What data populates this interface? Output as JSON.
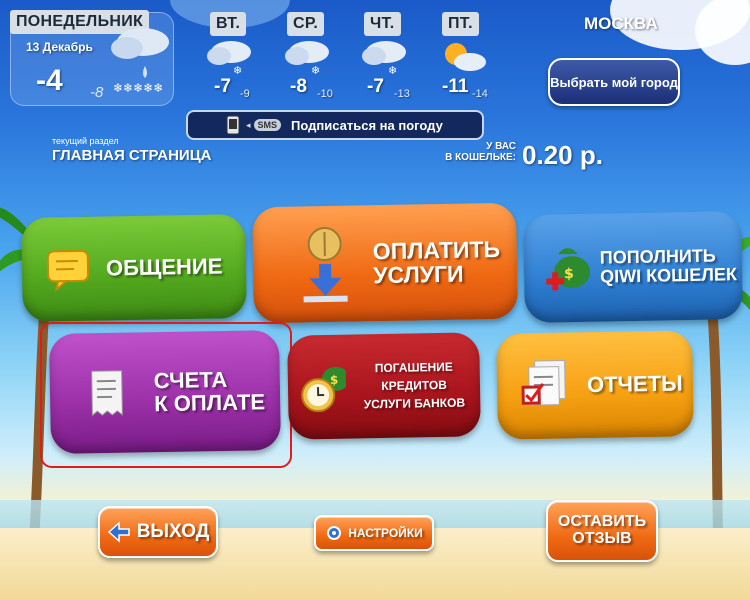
{
  "weather": {
    "today": {
      "day": "ПОНЕДЕЛЬНИК",
      "date": "13 Декабрь",
      "temp_hi": "-4",
      "temp_lo": "-8"
    },
    "forecast": [
      {
        "day": "ВТ.",
        "temp_hi": "-7",
        "temp_lo": "-9",
        "icon": "snow-cloud-icon"
      },
      {
        "day": "СР.",
        "temp_hi": "-8",
        "temp_lo": "-10",
        "icon": "snow-cloud-icon"
      },
      {
        "day": "ЧТ.",
        "temp_hi": "-7",
        "temp_lo": "-13",
        "icon": "snow-cloud-icon"
      },
      {
        "day": "ПТ.",
        "temp_hi": "-11",
        "temp_lo": "-14",
        "icon": "sun-cloud-icon"
      }
    ],
    "city": "МОСКВА",
    "choose_city": "Выбрать мой город",
    "subscribe_sms": "SMS",
    "subscribe_text": "Подписаться на погоду"
  },
  "section": {
    "caption": "текущий раздел",
    "name": "ГЛАВНАЯ СТРАНИЦА"
  },
  "wallet": {
    "line1": "У ВАС",
    "line2": "В КОШЕЛЬКЕ:",
    "amount": "0.20 р."
  },
  "tiles": {
    "communication": "ОБЩЕНИЕ",
    "pay_services_1": "ОПЛАТИТЬ",
    "pay_services_2": "УСЛУГИ",
    "topup_1": "ПОПОЛНИТЬ",
    "topup_2": "QIWI КОШЕЛЕК",
    "invoices_1": "СЧЕТА",
    "invoices_2": "К ОПЛАТЕ",
    "credits_1": "ПОГАШЕНИЕ КРЕДИТОВ",
    "credits_2": "УСЛУГИ БАНКОВ",
    "reports": "ОТЧЕТЫ"
  },
  "bottom": {
    "exit": "ВЫХОД",
    "settings": "НАСТРОЙКИ",
    "feedback_1": "ОСТАВИТЬ",
    "feedback_2": "ОТЗЫВ"
  },
  "colors": {
    "green": "#52a81e",
    "orange": "#f06a14",
    "blue": "#2f7fd2",
    "purple": "#9a2fa6",
    "red": "#a8141c",
    "yellow": "#f6a012",
    "highlight": "#e01b1b"
  }
}
